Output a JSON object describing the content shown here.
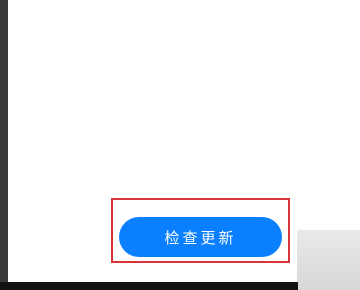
{
  "screen": {
    "check_update_button": "检查更新"
  },
  "colors": {
    "button": "#0a7fff",
    "highlight": "#d9333a"
  }
}
